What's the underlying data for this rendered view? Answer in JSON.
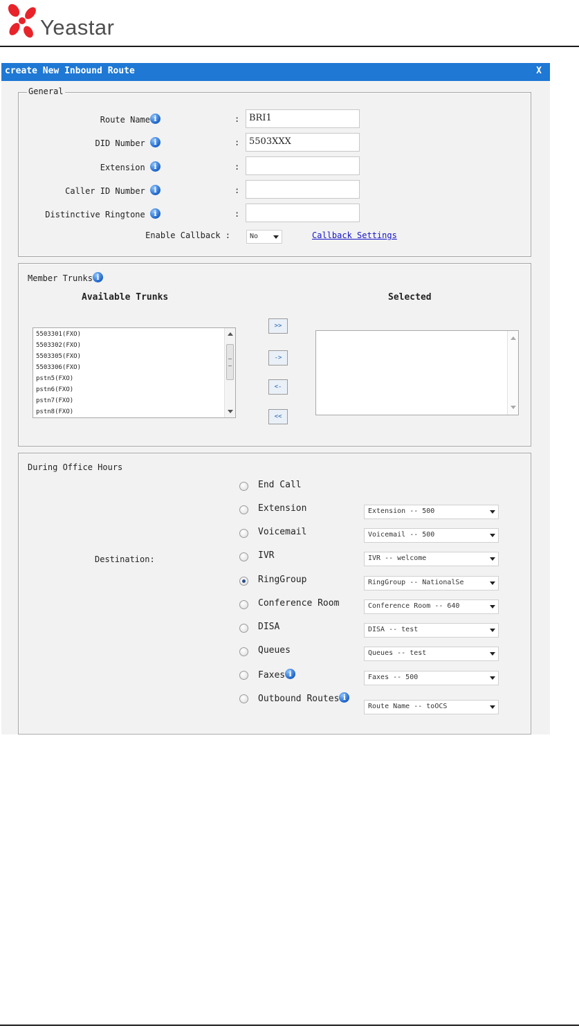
{
  "brand": {
    "name": "Yeastar"
  },
  "dialog": {
    "title": "create New Inbound Route",
    "close": "X",
    "colors": {
      "titlebar": "#1e78d4",
      "link": "#1515c8"
    }
  },
  "general": {
    "legend": "General",
    "fields": [
      {
        "label": "Route Name",
        "value": "BRI1"
      },
      {
        "label": "DID Number",
        "value": "5503XXX"
      },
      {
        "label": "Extension",
        "value": ""
      },
      {
        "label": "Caller ID Number",
        "value": ""
      },
      {
        "label": "Distinctive Ringtone",
        "value": ""
      }
    ],
    "colon": ":",
    "callback": {
      "label": "Enable Callback :",
      "value": "No",
      "link": "Callback Settings"
    }
  },
  "trunks": {
    "legend": "Member Trunks",
    "available_header": "Available Trunks",
    "selected_header": "Selected",
    "available": [
      "5503301(FXO)",
      "5503302(FXO)",
      "5503305(FXO)",
      "5503306(FXO)",
      "pstn5(FXO)",
      "pstn6(FXO)",
      "pstn7(FXO)",
      "pstn8(FXO)"
    ],
    "selected": [],
    "buttons": {
      "add_all": ">>",
      "add": "->",
      "remove": "<-",
      "remove_all": "<<"
    }
  },
  "office_hours": {
    "legend": "During Office Hours",
    "destination_label": "Destination:",
    "options": [
      {
        "label": "End Call",
        "select": "",
        "checked": false
      },
      {
        "label": "Extension",
        "select": "Extension -- 500",
        "checked": false
      },
      {
        "label": "Voicemail",
        "select": "Voicemail -- 500",
        "checked": false
      },
      {
        "label": "IVR",
        "select": "IVR -- welcome",
        "checked": false
      },
      {
        "label": "RingGroup",
        "select": "RingGroup -- NationalSe",
        "checked": true
      },
      {
        "label": "Conference Room",
        "select": "Conference Room -- 640",
        "checked": false
      },
      {
        "label": "DISA",
        "select": "DISA -- test",
        "checked": false
      },
      {
        "label": "Queues",
        "select": "Queues -- test",
        "checked": false
      },
      {
        "label": "Faxes",
        "select": "Faxes -- 500",
        "checked": false
      },
      {
        "label": "Outbound Routes",
        "select": "Route Name -- toOCS",
        "checked": false
      }
    ]
  }
}
